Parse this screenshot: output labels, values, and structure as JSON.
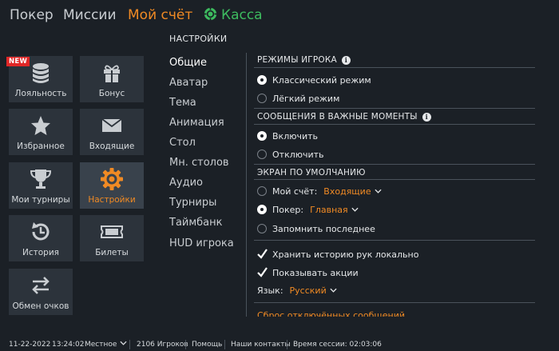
{
  "nav": {
    "poker": "Покер",
    "missions": "Миссии",
    "account": "Мой счёт",
    "cashier": "Касса"
  },
  "settings_title": "НАСТРОЙКИ",
  "badge_new": "NEW",
  "tiles": [
    {
      "label": "Лояльность",
      "icon": "coins-icon"
    },
    {
      "label": "Бонус",
      "icon": "gift-icon"
    },
    {
      "label": "Избранное",
      "icon": "star-icon"
    },
    {
      "label": "Входящие",
      "icon": "envelope-icon"
    },
    {
      "label": "Мои турниры",
      "icon": "trophy-icon"
    },
    {
      "label": "Настройки",
      "icon": "gear-icon"
    },
    {
      "label": "История",
      "icon": "history-icon"
    },
    {
      "label": "Билеты",
      "icon": "ticket-icon"
    },
    {
      "label": "Обмен очков",
      "icon": "exchange-icon"
    }
  ],
  "menu": [
    "Общие",
    "Аватар",
    "Тема",
    "Анимация",
    "Стол",
    "Мн. столов",
    "Аудио",
    "Турниры",
    "Таймбанк",
    "HUD игрока"
  ],
  "player_modes": {
    "title": "РЕЖИМЫ ИГРОКА",
    "options": [
      "Классический режим",
      "Лёгкий режим"
    ]
  },
  "important_msgs": {
    "title": "СООБЩЕНИЯ В ВАЖНЫЕ МОМЕНТЫ",
    "options": [
      "Включить",
      "Отключить"
    ]
  },
  "default_screen": {
    "title": "ЭКРАН ПО УМОЛЧАНИЮ",
    "account_label": "Мой счёт:",
    "account_value": "Входящие",
    "poker_label": "Покер:",
    "poker_value": "Главная",
    "remember": "Запомнить последнее"
  },
  "checks": {
    "save_history": "Хранить историю рук локально",
    "show_promos": "Показывать акции"
  },
  "language": {
    "label": "Язык:",
    "value": "Русский"
  },
  "reset_link": "Сброс отключённых сообщений",
  "status": {
    "date": "11-22-2022",
    "time": "13:24:02",
    "timezone": "Местное",
    "players": "2106 Игроков",
    "help": "Помощь",
    "contacts": "Наши контакты",
    "session": "Время сессии: 02:03:06"
  },
  "colors": {
    "accent": "#f08a24",
    "cashier": "#3dbb5f",
    "new_badge": "#e12727"
  }
}
